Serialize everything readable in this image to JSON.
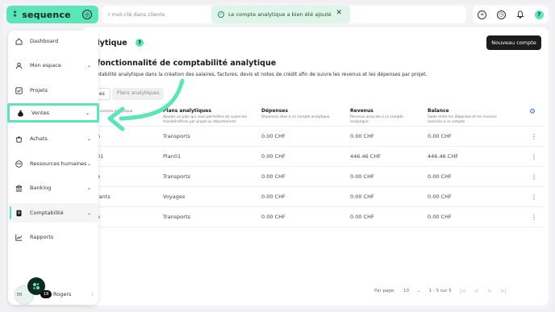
{
  "brand": {
    "logo_mark": "⁑",
    "name": "sequence",
    "badge": "◎",
    "accent": "#5ce6b8"
  },
  "search": {
    "placeholder": "r mot-clé dans clients"
  },
  "toast": {
    "icon": "check-circle-icon",
    "text": "Le compte analytique a bien été ajouté",
    "close": "✕"
  },
  "topicons": {
    "add": "+",
    "clock": "◷",
    "bell": "🔔",
    "help": "?"
  },
  "page": {
    "title": "alytique",
    "help": "?",
    "new_account_button": "Nouveau compte",
    "info_title": "fonctionnalité de comptabilité analytique",
    "info_text": "otabilité analytique dans la création des salaires, factures, devis et notes de crédit afin de suivre les revenus et les dépenses par projet.",
    "tabs": [
      "es",
      "Plans analytiques"
    ]
  },
  "table": {
    "headers": [
      {
        "title": "",
        "sub": "e compte analytique"
      },
      {
        "title": "Plans analytiques",
        "sub": "Ajouter un plan qui vous permettre de suivre les frais/bénéfices par projet ou département."
      },
      {
        "title": "Dépenses",
        "sub": "Dépenses liées à ce compte analytique"
      },
      {
        "title": "Revenus",
        "sub": "Revenus associés à ce compte analytique"
      },
      {
        "title": "Balance",
        "sub": "Solde entre les dépenses et les revenus associés à ce compte"
      }
    ],
    "rows": [
      {
        "name": "n",
        "plan": "Transports",
        "expenses": "0.00 CHF",
        "revenue": "0.00 CHF",
        "balance": "0.00 CHF"
      },
      {
        "name": "01",
        "plan": "Plan01",
        "expenses": "0.00 CHF",
        "revenue": "446.46 CHF",
        "balance": "446.46 CHF"
      },
      {
        "name": "e",
        "plan": "Transports",
        "expenses": "0.00 CHF",
        "revenue": "0.00 CHF",
        "balance": "0.00 CHF"
      },
      {
        "name": "rants",
        "plan": "Voyages",
        "expenses": "0.00 CHF",
        "revenue": "0.00 CHF",
        "balance": "0.00 CHF"
      },
      {
        "name": "e",
        "plan": "Transports",
        "expenses": "0.00 CHF",
        "revenue": "0.00 CHF",
        "balance": "0.00 CHF"
      }
    ],
    "row_menu": "⋮"
  },
  "pagination": {
    "per_page_label": "Par page:",
    "per_page_value": "10",
    "range": "1 - 5 sur 5",
    "first": "|<",
    "prev": "<",
    "next": ">",
    "last": ">|"
  },
  "sidebar": {
    "items": [
      {
        "label": "Dashboard",
        "icon": "home-icon"
      },
      {
        "label": "Mon espace",
        "icon": "person-icon",
        "chevron": "⌄"
      },
      {
        "label": "Projets",
        "icon": "checkbox-icon"
      },
      {
        "label": "Ventes",
        "icon": "money-bag-icon",
        "chevron": "⌄"
      },
      {
        "label": "Achats",
        "icon": "shopping-bag-icon",
        "chevron": "⌄"
      },
      {
        "label": "Ressources humaines",
        "icon": "people-icon",
        "chevron": "⌄"
      },
      {
        "label": "Banking",
        "icon": "bank-icon",
        "chevron": "⌄"
      },
      {
        "label": "Comptabilité",
        "icon": "ledger-icon",
        "chevron": "⌄"
      },
      {
        "label": "Rapports",
        "icon": "chart-icon"
      }
    ],
    "user": {
      "initials": "ER",
      "badge": "18",
      "name": "Rogers",
      "chevron": "›"
    }
  }
}
